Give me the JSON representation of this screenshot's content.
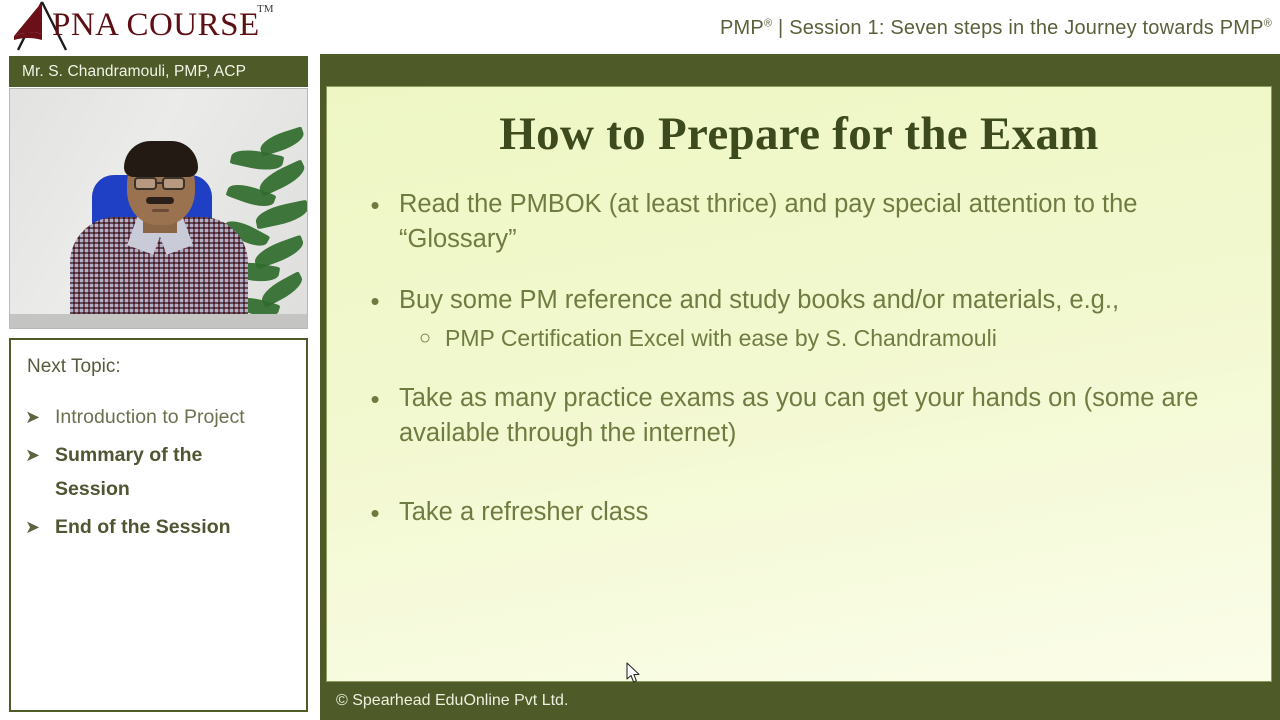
{
  "header": {
    "logo_text": "PNA COURSE",
    "logo_tm": "TM",
    "logo_mark_icon": "mountain-triangle-icon",
    "session_title_prefix": "PMP",
    "session_title_reg1": "®",
    "session_title_middle": " | Session 1: Seven steps in the Journey towards  PMP",
    "session_title_reg2": "®",
    "session_title_full": "PMP® | Session 1: Seven steps in the Journey towards  PMP®"
  },
  "presenter": {
    "name_bar": "Mr. S. Chandramouli, PMP, ACP",
    "video_alt": "presenter-video-feed"
  },
  "next_topic": {
    "heading": "Next Topic:",
    "arrow_glyph": "➤",
    "items": [
      {
        "label": "Introduction to Project",
        "bold": false
      },
      {
        "label": "Summary of the Session",
        "bold": true
      },
      {
        "label": "End of the Session",
        "bold": true
      }
    ]
  },
  "slide": {
    "title": "How to Prepare for the Exam",
    "bullet_glyph": "•",
    "sub_bullet_glyph": "○",
    "bullets": [
      {
        "text": "Read the PMBOK (at least thrice) and pay special attention to the “Glossary”",
        "subs": []
      },
      {
        "text": "Buy some PM reference and study books and/or materials, e.g.,",
        "subs": [
          "PMP Certification Excel with ease by S. Chandramouli"
        ]
      },
      {
        "text": "Take as many practice exams as you can get your hands on (some are available through the internet)",
        "subs": []
      },
      {
        "text": "Take a refresher class",
        "subs": []
      }
    ],
    "footer": "© Spearhead EduOnline Pvt Ltd."
  },
  "colors": {
    "brand_green": "#4e5a27",
    "slide_bg": "#eef7c4",
    "body_text": "#6f7c41",
    "title_text": "#3d4a1d",
    "logo_maroon": "#5d0f14",
    "header_text": "#59603a"
  }
}
